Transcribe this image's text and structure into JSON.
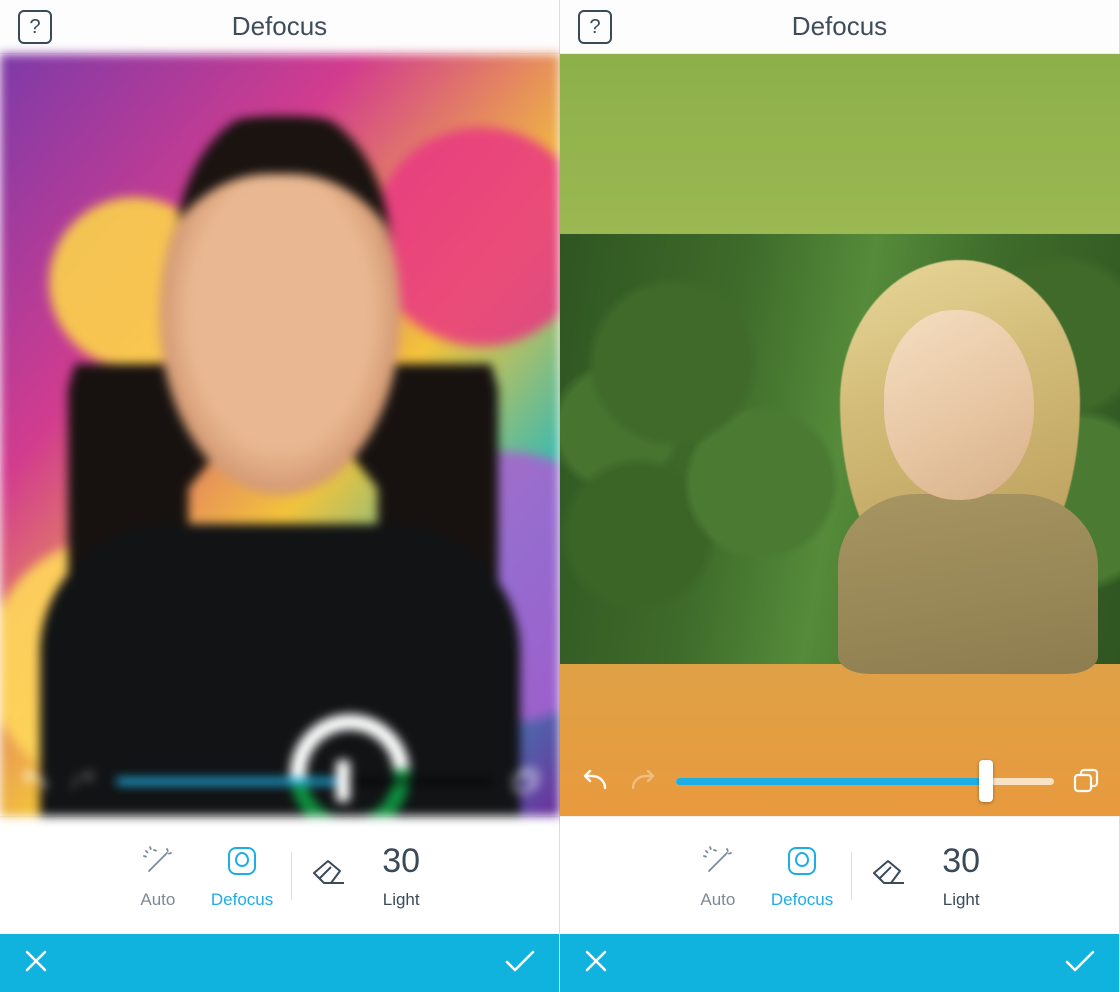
{
  "panes": [
    {
      "header": {
        "title": "Defocus"
      },
      "slider": {
        "value": 60,
        "fill_percent": 60
      },
      "tools": {
        "auto": "Auto",
        "defocus": "Defocus",
        "light_value": "30",
        "light_label": "Light"
      }
    },
    {
      "header": {
        "title": "Defocus"
      },
      "slider": {
        "value": 82,
        "fill_percent": 82
      },
      "tools": {
        "auto": "Auto",
        "defocus": "Defocus",
        "light_value": "30",
        "light_label": "Light"
      }
    }
  ],
  "colors": {
    "accent": "#1eaee3",
    "bottom": "#0fb3dd"
  }
}
